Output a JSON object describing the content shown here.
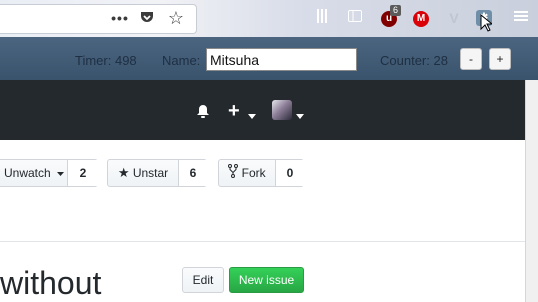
{
  "browser": {
    "url_toolbar": {
      "page_actions_icon": "ellipsis-icon",
      "pocket_icon": "pocket-icon",
      "bookmark_icon": "star-icon"
    },
    "extensions": {
      "ublock_count": "6"
    }
  },
  "extension_bar": {
    "timer_label": "Timer: 498",
    "name_label": "Name:",
    "name_value": "Mitsuha",
    "counter_label": "Counter: 28",
    "decrement_label": "-",
    "increment_label": "+"
  },
  "repo_actions": {
    "unwatch_label": "Unwatch",
    "unwatch_count": "2",
    "unstar_label": "Unstar",
    "unstar_count": "6",
    "fork_label": "Fork",
    "fork_count": "0"
  },
  "issue": {
    "title_fragment": "without",
    "edit_label": "Edit",
    "new_issue_label": "New issue"
  },
  "colors": {
    "header_bg": "#24292e",
    "extension_bar_bg": "#3f5873",
    "new_issue_green": "#28a745"
  }
}
